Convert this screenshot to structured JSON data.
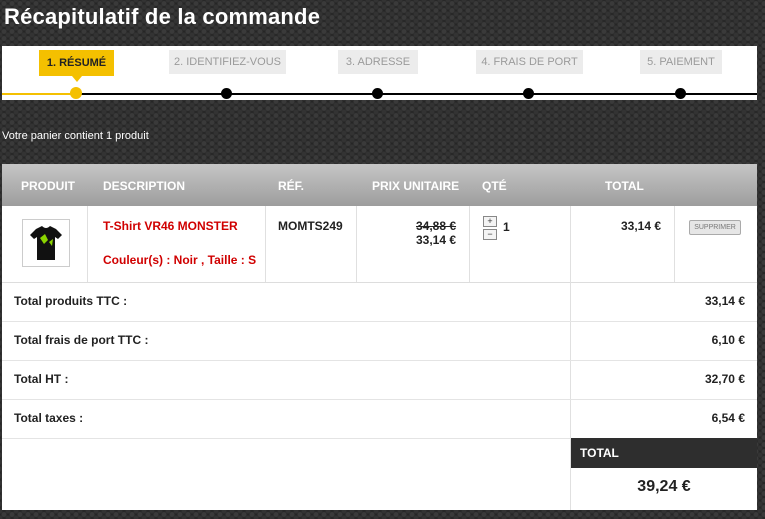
{
  "page": {
    "title": "Récapitulatif de la commande"
  },
  "steps": [
    {
      "label": "1. RÉSUMÉ",
      "active": true
    },
    {
      "label": "2. IDENTIFIEZ-VOUS",
      "active": false
    },
    {
      "label": "3. ADRESSE",
      "active": false
    },
    {
      "label": "4. FRAIS DE PORT",
      "active": false
    },
    {
      "label": "5. PAIEMENT",
      "active": false
    }
  ],
  "cart_info": "Votre panier contient 1 produit",
  "table": {
    "headers": {
      "product": "PRODUIT",
      "description": "DESCRIPTION",
      "ref": "RÉF.",
      "unit_price": "PRIX UNITAIRE",
      "qty": "QTÉ",
      "total": "TOTAL"
    },
    "item": {
      "name": "T-Shirt VR46 MONSTER",
      "attributes": "Couleur(s) : Noir , Taille : S",
      "ref": "MOMTS249",
      "old_price": "34,88 €",
      "price": "33,14 €",
      "qty_plus": "+",
      "qty_minus": "−",
      "qty": "1",
      "total": "33,14 €",
      "delete_label": "SUPPRIMER",
      "image_icon": "tshirt-icon"
    }
  },
  "summary": [
    {
      "label": "Total produits TTC :",
      "value": "33,14 €"
    },
    {
      "label": "Total frais de port TTC :",
      "value": "6,10 €"
    },
    {
      "label": "Total HT :",
      "value": "32,70 €"
    },
    {
      "label": "Total taxes :",
      "value": "6,54 €"
    }
  ],
  "grand_total": {
    "label": "TOTAL",
    "value": "39,24 €"
  },
  "colors": {
    "accent": "#f4c000",
    "product_red": "#d00000",
    "dark": "#2e2e2e"
  }
}
